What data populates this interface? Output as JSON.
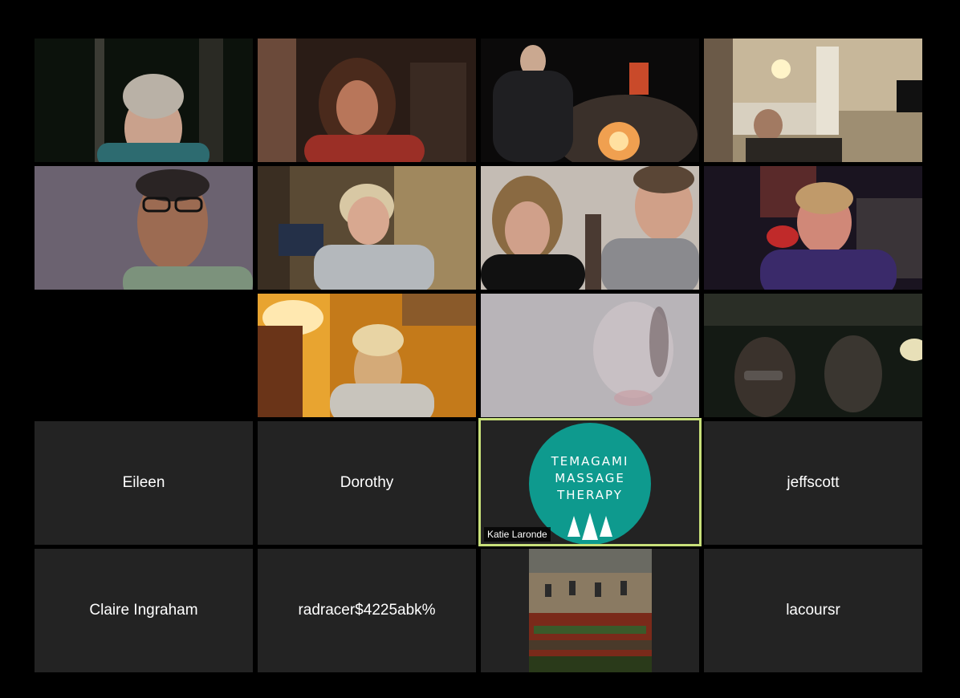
{
  "participants": {
    "eileen": "Eileen",
    "dorothy": "Dorothy",
    "jeffscott": "jeffscott",
    "claire": "Claire Ingraham",
    "radracer": "radracer$4225abk%",
    "lacoursr": "lacoursr",
    "katie": "Katie Laronde"
  },
  "logo": {
    "line1": "TEMAGAMI",
    "line2": "MASSAGE",
    "line3": "THERAPY",
    "icon": "pine-trees-icon",
    "color": "#0e9a8e"
  },
  "active_speaker_border": "#c8e07a"
}
